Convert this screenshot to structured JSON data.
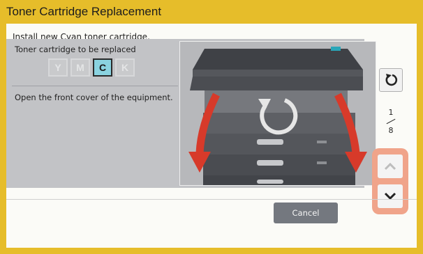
{
  "title": "Toner Cartridge Replacement",
  "instruction": "Install new Cyan toner cartridge.",
  "cartridge": {
    "label": "Toner cartridge to be replaced",
    "options": [
      "Y",
      "M",
      "C",
      "K"
    ],
    "selected": "C"
  },
  "step_text": "Open the front cover of the equipment.",
  "step": {
    "current": "1",
    "total": "8"
  },
  "buttons": {
    "cancel": "Cancel"
  },
  "icons": {
    "restart": "restart-icon",
    "up": "chevron-up-icon",
    "down": "chevron-down-icon",
    "illustration_rotate": "rotate-arrow-icon",
    "illustration_arrows": "down-arrow-icon"
  },
  "colors": {
    "header": "#e6bd2a",
    "selected_cartridge": "#8ad3e0",
    "nav_highlight": "#f0a48a",
    "arrow_red": "#d73a2a",
    "cancel_button": "#74787f"
  }
}
